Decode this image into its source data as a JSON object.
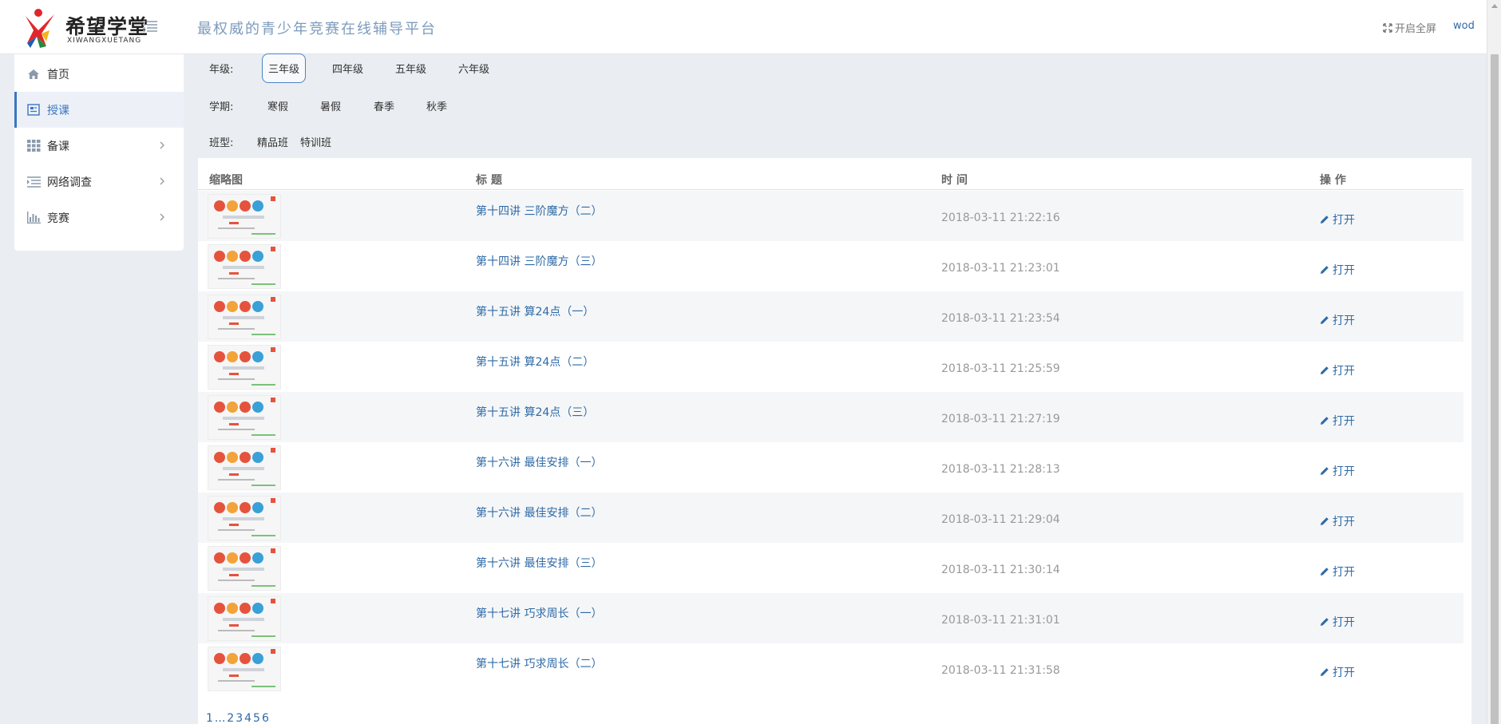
{
  "header": {
    "logo_cn": "希望学堂",
    "logo_en": "XIWANGXUETANG",
    "slogan": "最权威的青少年竞赛在线辅导平台",
    "fullscreen_label": "开启全屏",
    "user": "wod"
  },
  "sidebar": {
    "items": [
      {
        "label": "首页",
        "icon": "home-icon",
        "active": false,
        "has_arrow": false
      },
      {
        "label": "授课",
        "icon": "lesson-icon",
        "active": true,
        "has_arrow": false
      },
      {
        "label": "备课",
        "icon": "grid-icon",
        "active": false,
        "has_arrow": true
      },
      {
        "label": "网络调查",
        "icon": "survey-icon",
        "active": false,
        "has_arrow": true
      },
      {
        "label": "竞赛",
        "icon": "bar-chart-icon",
        "active": false,
        "has_arrow": true
      }
    ]
  },
  "filters": {
    "grade_label": "年级:",
    "grades": [
      "三年级",
      "四年级",
      "五年级",
      "六年级"
    ],
    "grade_selected": "三年级",
    "term_label": "学期:",
    "terms": [
      "寒假",
      "暑假",
      "春季",
      "秋季"
    ],
    "class_label": "班型:",
    "classes": [
      "精品班",
      "特训班"
    ]
  },
  "table": {
    "headers": {
      "thumb": "缩略图",
      "title": "标 题",
      "time": "时 间",
      "action": "操 作"
    },
    "open_label": "打开",
    "rows": [
      {
        "title": "第十四讲 三阶魔方（二）",
        "time": "2018-03-11 21:22:16"
      },
      {
        "title": "第十四讲 三阶魔方（三）",
        "time": "2018-03-11 21:23:01"
      },
      {
        "title": "第十五讲 算24点（一）",
        "time": "2018-03-11 21:23:54"
      },
      {
        "title": "第十五讲 算24点（二）",
        "time": "2018-03-11 21:25:59"
      },
      {
        "title": "第十五讲 算24点（三）",
        "time": "2018-03-11 21:27:19"
      },
      {
        "title": "第十六讲 最佳安排（一）",
        "time": "2018-03-11 21:28:13"
      },
      {
        "title": "第十六讲 最佳安排（二）",
        "time": "2018-03-11 21:29:04"
      },
      {
        "title": "第十六讲 最佳安排（三）",
        "time": "2018-03-11 21:30:14"
      },
      {
        "title": "第十七讲 巧求周长（一）",
        "time": "2018-03-11 21:31:01"
      },
      {
        "title": "第十七讲 巧求周长（二）",
        "time": "2018-03-11 21:31:58"
      }
    ]
  },
  "pager": [
    "1",
    "...",
    "2",
    "3",
    "4",
    "5",
    "6"
  ],
  "colors": {
    "accent": "#2e6aa6",
    "slogan": "#7d9bbc",
    "bg": "#eaedf1"
  }
}
